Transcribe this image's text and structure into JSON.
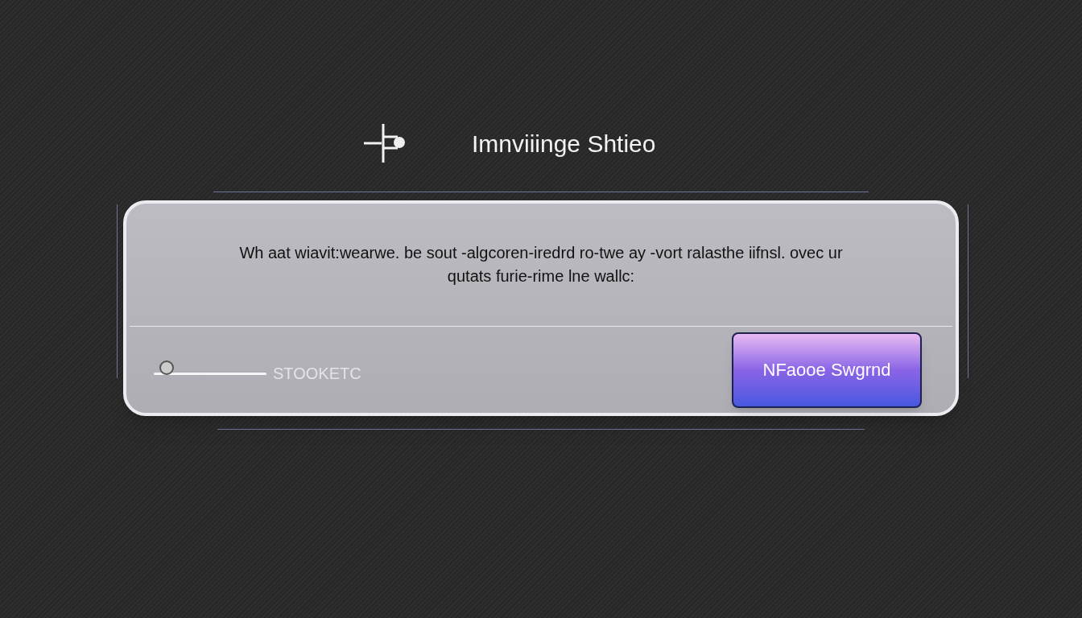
{
  "header": {
    "title": "Imnviiinge Shtieo"
  },
  "dialog": {
    "message": "Wh aat wiavit:wearwe. be sout ‐algcoren-iredrd ro-twe ay -vort ralasthe iifnsl. ovec ur qutats furie-rime lne wallc:",
    "slider": {
      "level": 0.06,
      "label": "STOOKETC"
    },
    "button": {
      "label": "NFaooe Swgrnd"
    }
  }
}
